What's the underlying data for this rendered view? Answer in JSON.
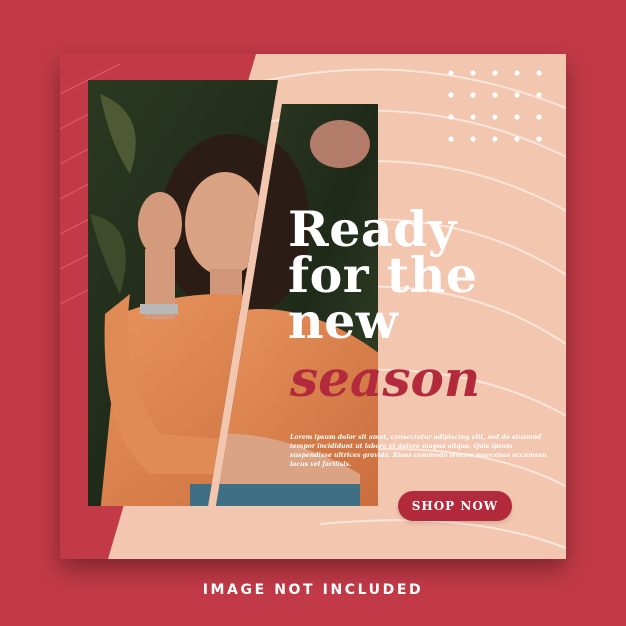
{
  "headline": {
    "line1": "Ready",
    "line2": "for the",
    "line3": "new",
    "accent": "season"
  },
  "body_copy": "Lorem ipsum dolor sit amet, consectetur adipiscing elit, sed do eiusmod tempor incididunt ut labore et dolore magna aliqua. Quis ipsum suspendisse ultrices gravida. Risus commodo viverra maecenas accumsan lacus vel facilisis.",
  "button": {
    "label": "SHOP NOW"
  },
  "footer_note": "IMAGE NOT INCLUDED",
  "colors": {
    "background": "#c23a48",
    "card": "#f3c6b0",
    "accent": "#b32a3c",
    "text_light": "#ffffff"
  },
  "icons": [
    "dot-grid-decoration",
    "diagonal-stripe-decoration",
    "curved-line-decoration"
  ]
}
